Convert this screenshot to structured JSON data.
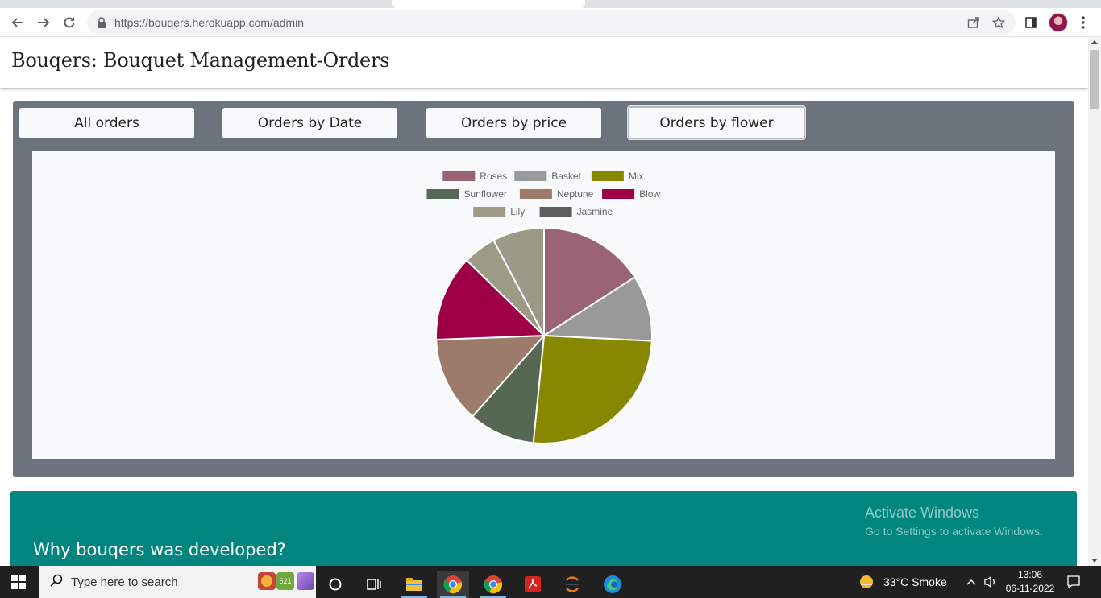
{
  "browser": {
    "url": "https://bouqers.herokuapp.com/admin"
  },
  "header": {
    "title": "Bouqers: Bouquet Management-Orders"
  },
  "tabs": [
    {
      "label": "All orders"
    },
    {
      "label": "Orders by Date"
    },
    {
      "label": "Orders by price"
    },
    {
      "label": "Orders by flower",
      "active": true
    }
  ],
  "chart_data": {
    "type": "pie",
    "legend_position": "top",
    "slices": [
      {
        "label": "Roses",
        "value": 16,
        "color": "#9a6474"
      },
      {
        "label": "Basket",
        "value": 10,
        "color": "#999999"
      },
      {
        "label": "Mix",
        "value": 26,
        "color": "#888700"
      },
      {
        "label": "Sunflower",
        "value": 10,
        "color": "#566753"
      },
      {
        "label": "Neptune",
        "value": 13,
        "color": "#9d7b6a"
      },
      {
        "label": "Blow",
        "value": 13,
        "color": "#9e0048"
      },
      {
        "label": "Lily",
        "value": 5,
        "color": "#9d9b86"
      },
      {
        "label": "Jasmine",
        "value": 7.8,
        "color": "#9c9a86"
      }
    ],
    "legend_colors": {
      "Jasmine": "#5e5e5e"
    }
  },
  "info": {
    "title": "Why bouqers was developed?"
  },
  "watermark": {
    "line1": "Activate Windows",
    "line2": "Go to Settings to activate Windows."
  },
  "taskbar": {
    "search_placeholder": "Type here to search",
    "weather": "33°C  Smoke",
    "time": "13:06",
    "date": "06-11-2022",
    "badge": "521"
  }
}
